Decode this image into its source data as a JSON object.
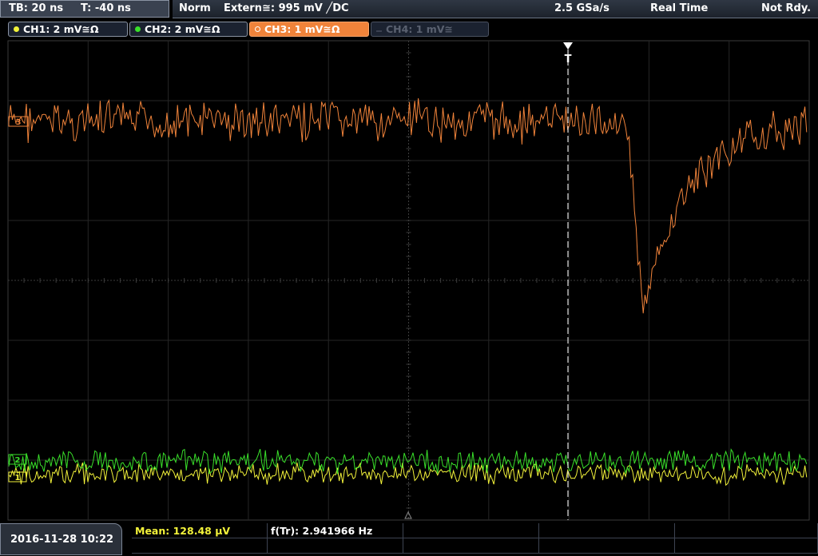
{
  "timebase": {
    "tb_label": "TB: 20 ns",
    "trigger_time_label": "T: -40 ns"
  },
  "status": {
    "mode": "Norm",
    "trigger_source": "Extern≅: 995 mV ╱DC",
    "sample_rate": "2.5 GSa/s",
    "acq_mode": "Real Time",
    "state": "Not Rdy."
  },
  "channels": [
    {
      "label": "CH1: 2 mV≅Ω",
      "color": "#f2f23a",
      "state": "on"
    },
    {
      "label": "CH2: 2 mV≅Ω",
      "color": "#39e02a",
      "state": "on"
    },
    {
      "label": "CH3: 1 mV≅Ω",
      "color": "#f0833a",
      "state": "selected"
    },
    {
      "label": "CH4: 1 mV≅",
      "color": "#5a6170",
      "state": "off"
    }
  ],
  "markers": {
    "ch3_ref": "3",
    "ch2_ref": "2",
    "ch1_ref": "1",
    "trigger": "T"
  },
  "measurements": {
    "mean": "Mean: 128.48 µV",
    "freq": "f(Tr): 2.941966 Hz"
  },
  "datetime": "2016-11-28 10:22",
  "colors": {
    "ch1": "#f2f23a",
    "ch2": "#39e02a",
    "ch3": "#f0833a",
    "grid": "#2e2e2e",
    "background": "#000000"
  }
}
